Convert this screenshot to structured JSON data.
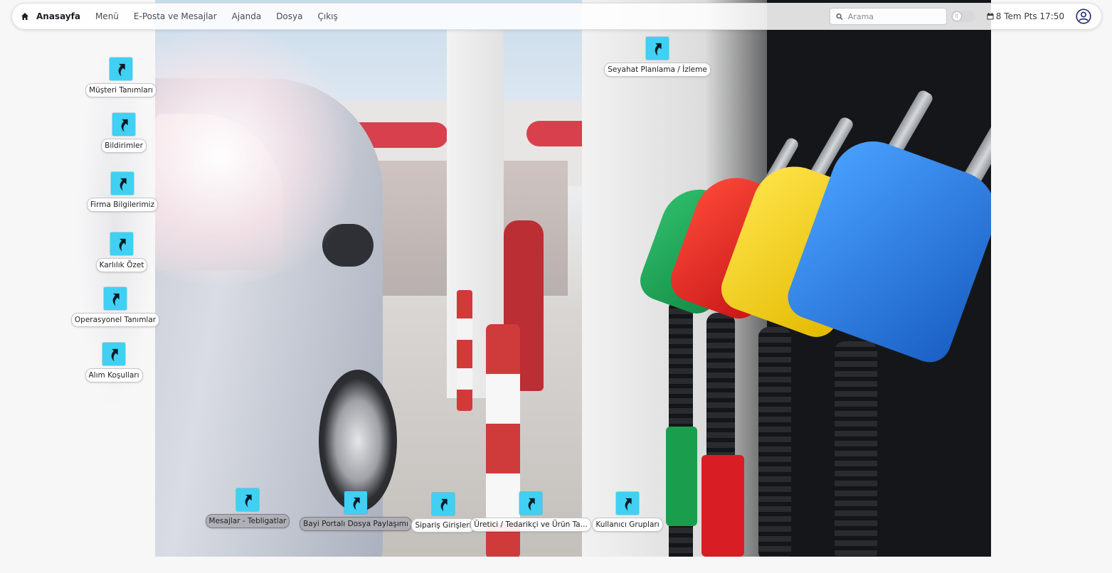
{
  "navbar": {
    "home_label": "Anasayfa",
    "items": [
      {
        "label": "Menü"
      },
      {
        "label": "E-Posta ve Mesajlar"
      },
      {
        "label": "Ajanda"
      },
      {
        "label": "Dosya"
      },
      {
        "label": "Çıkış"
      }
    ],
    "search_placeholder": "Arama",
    "date_text": "8 Tem Pts 17:50",
    "icons": {
      "home": "home-icon",
      "search": "search-icon",
      "calendar": "calendar-icon",
      "user": "user-circle-icon",
      "theme_toggle": "theme-toggle"
    }
  },
  "shortcuts": {
    "left": [
      {
        "label": "Müşteri Tanımları"
      },
      {
        "label": "Bildirimler"
      },
      {
        "label": "Firma Bilgilerimiz"
      },
      {
        "label": "Karlılık Özet"
      },
      {
        "label": "Operasyonel Tanımlar"
      },
      {
        "label": "Alım Koşulları"
      }
    ],
    "top": [
      {
        "label": "Seyahat Planlama / İzleme"
      }
    ],
    "bottom": [
      {
        "label": "Mesajlar - Tebligatlar"
      },
      {
        "label": "Bayi Portalı Dosya Paylaşımı"
      },
      {
        "label": "Sipariş Girişleri"
      },
      {
        "label": "Üretici / Tedarikçi ve Ürün Ta..."
      },
      {
        "label": "Kullanıcı Grupları"
      }
    ],
    "icon_name": "shortcut-arrow-icon",
    "icon_color": "#3fd0f3"
  },
  "background": {
    "accent_red": "#d8404e",
    "nozzle_colors": [
      "#1aa35a",
      "#e02020",
      "#f5d00a",
      "#2a78d6"
    ]
  }
}
